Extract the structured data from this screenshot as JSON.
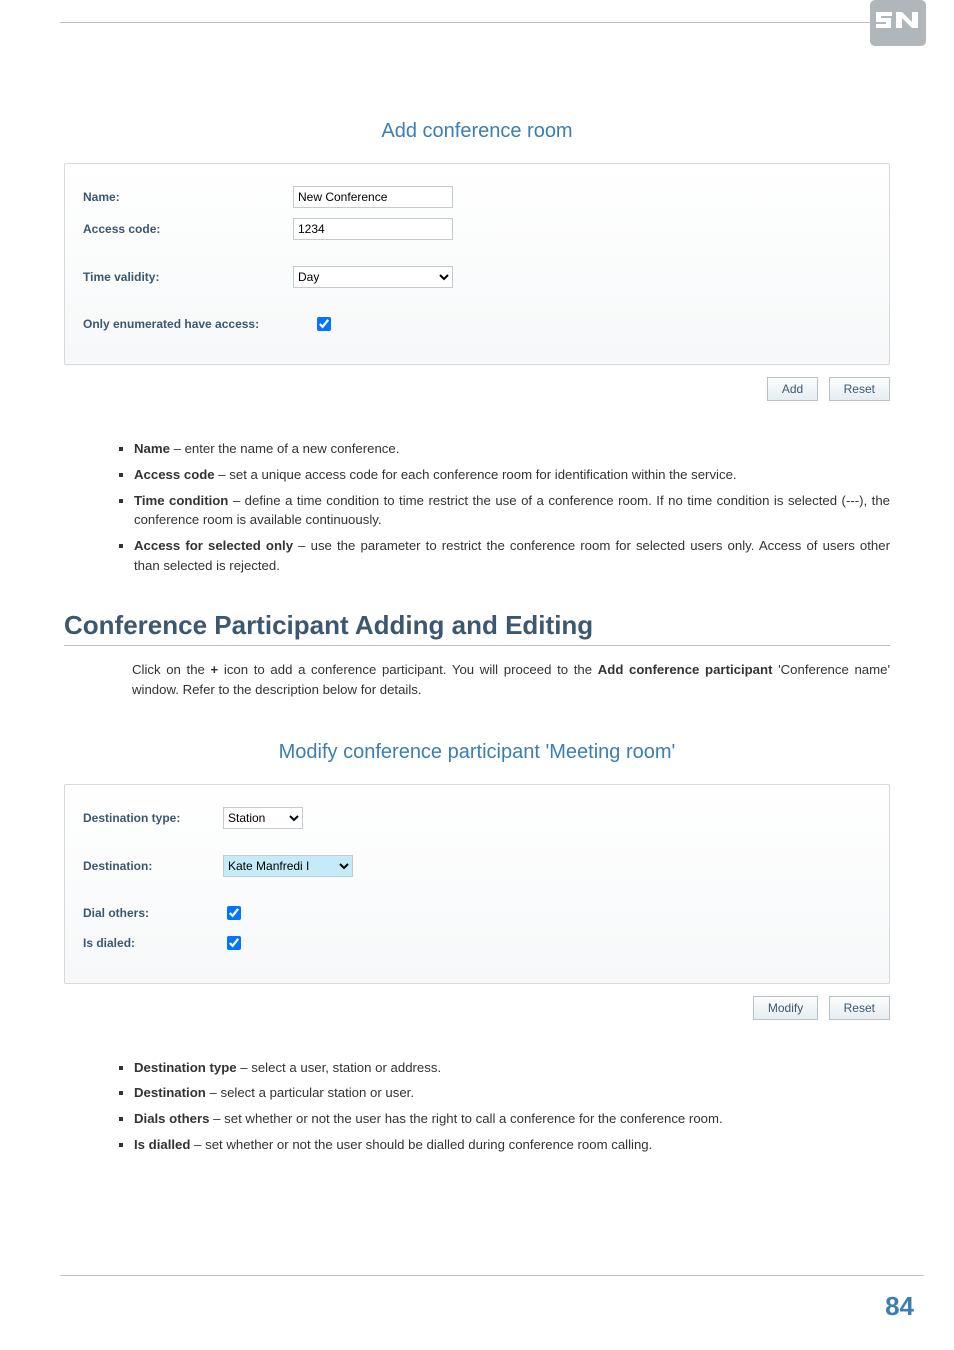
{
  "section1": {
    "caption": "Add conference room",
    "name_label": "Name:",
    "name_value": "New Conference",
    "access_code_label": "Access code:",
    "access_code_value": "1234",
    "time_validity_label": "Time validity:",
    "time_validity_value": "Day",
    "only_enum_label": "Only enumerated have access:",
    "btn_add": "Add",
    "btn_reset": "Reset"
  },
  "bullets1": {
    "b1_strong": "Name",
    "b1_text": " – enter the name of a new conference.",
    "b2_strong": "Access code",
    "b2_text": " – set a unique access code for each conference room for identification within the service.",
    "b3_strong": "Time condition",
    "b3_text": " – define a time condition to time restrict the use of a conference room. If no time condition is selected (---), the conference room is available continuously.",
    "b4_strong": "Access for selected only",
    "b4_text": " – use the parameter to restrict the conference room for selected users only. Access of users other than selected is rejected."
  },
  "heading": "Conference Participant Adding and Editing",
  "intro_pre": "Click on the ",
  "intro_plus": "+",
  "intro_mid": " icon to add a conference participant. You will proceed to the ",
  "intro_strong2": "Add conference participant",
  "intro_post": " 'Conference name' window. Refer to the description below for details.",
  "section2": {
    "caption": "Modify conference participant 'Meeting room'",
    "dest_type_label": "Destination type:",
    "dest_type_value": "Station",
    "destination_label": "Destination:",
    "destination_value": "Kate Manfredi I",
    "dial_others_label": "Dial others:",
    "is_dialed_label": "Is dialed:",
    "btn_modify": "Modify",
    "btn_reset": "Reset"
  },
  "bullets2": {
    "b1_strong": "Destination type",
    "b1_text": " – select a user, station or address.",
    "b2_strong": "Destination",
    "b2_text": " – select a particular station or user.",
    "b3_strong": "Dials others",
    "b3_text": " – set whether or not the user has the right to call a conference for the conference room.",
    "b4_strong": "Is dialled",
    "b4_text": " – set whether or not the user should be dialled during conference room calling."
  },
  "page_number": "84"
}
